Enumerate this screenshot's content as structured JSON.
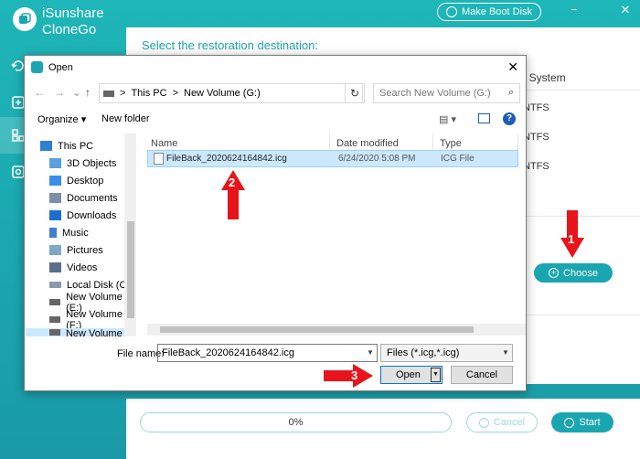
{
  "app": {
    "name_line1": "iSunshare",
    "name_line2": "CloneGo",
    "boot_button": "Make Boot Disk",
    "heading": "Select the restoration destination:",
    "fs_column": "le System",
    "fs_values": [
      "NTFS",
      "NTFS",
      "NTFS"
    ],
    "choose_button": "Choose",
    "progress_text": "0%",
    "progress_value": 0,
    "cancel_button": "Cancel",
    "start_button": "Start",
    "window_controls": {
      "minimize": "−",
      "close": "✕"
    },
    "accent_color": "#1aa6b0"
  },
  "annotations": {
    "arrow1": "1",
    "arrow2": "2",
    "arrow3": "3",
    "arrow_color": "#e8141b"
  },
  "dialog": {
    "title": "Open",
    "close": "✕",
    "nav": {
      "back": "←",
      "forward": "→",
      "dropdown": "⌄",
      "up": "↑"
    },
    "address": {
      "root": "This PC",
      "sep": ">",
      "location": "New Volume (G:)"
    },
    "refresh": "↻",
    "search_placeholder": "Search New Volume (G:)",
    "toolbar": {
      "organize": "Organize ▾",
      "new_folder": "New folder",
      "help": "?"
    },
    "tree": [
      {
        "label": "This PC",
        "icon": "pc-icon"
      },
      {
        "label": "3D Objects",
        "icon": "cube-icon"
      },
      {
        "label": "Desktop",
        "icon": "desktop-icon"
      },
      {
        "label": "Documents",
        "icon": "documents-icon"
      },
      {
        "label": "Downloads",
        "icon": "download-icon"
      },
      {
        "label": "Music",
        "icon": "music-icon"
      },
      {
        "label": "Pictures",
        "icon": "pictures-icon"
      },
      {
        "label": "Videos",
        "icon": "videos-icon"
      },
      {
        "label": "Local Disk (C:)",
        "icon": "drive-icon"
      },
      {
        "label": "New Volume (E:)",
        "icon": "drive-icon"
      },
      {
        "label": "New Volume (F:)",
        "icon": "drive-icon"
      },
      {
        "label": "New Volume (G:)",
        "icon": "drive-icon"
      }
    ],
    "columns": {
      "name": "Name",
      "date": "Date modified",
      "type": "Type"
    },
    "files": [
      {
        "name": "FileBack_2020624164842.icg",
        "date": "6/24/2020 5:08 PM",
        "type": "ICG File"
      }
    ],
    "filename_label": "File name:",
    "filename_value": "FileBack_2020624164842.icg",
    "filetype_value": "Files (*.icg,*.icg)",
    "open_button": "Open",
    "cancel_button": "Cancel"
  }
}
